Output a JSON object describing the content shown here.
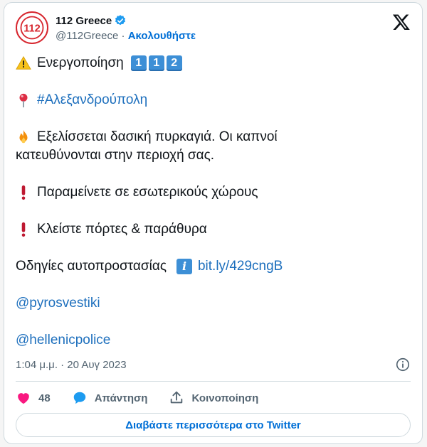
{
  "account": {
    "display_name": "112 Greece",
    "handle": "@112Greece",
    "separator": " · ",
    "follow_label": "Ακολουθήστε",
    "avatar_text": "112"
  },
  "tweet": {
    "activation_text": "Ενεργοποίηση",
    "activation_keys": [
      "1",
      "1",
      "2"
    ],
    "location_hashtag": "#Αλεξανδρούπολη",
    "fire_line_1": "Εξελίσσεται δασική πυρκαγιά. Οι καπνοί",
    "fire_line_2": "κατευθύνονται στην περιοχή σας.",
    "stay_indoors": "Παραμείνετε σε εσωτερικούς χώρους",
    "close_doors": "Κλείστε πόρτες & παράθυρα",
    "self_protection": "Οδηγίες αυτοπροστασίας",
    "link": "bit.ly/429cngB",
    "mention_1": "@pyrosvestiki",
    "mention_2": "@hellenicpolice"
  },
  "meta": {
    "timestamp": "1:04 μ.μ. · 20 Αυγ 2023"
  },
  "actions": {
    "likes_count": "48",
    "reply_label": "Απάντηση",
    "share_label": "Κοινοποίηση"
  },
  "read_more_label": "Διαβάστε περισσότερα στο Twitter",
  "colors": {
    "link": "#1d6fbd",
    "follow": "#006fd6",
    "like": "#f91880",
    "verified": "#1d9bf0",
    "keycap": "#3d8fd6"
  }
}
